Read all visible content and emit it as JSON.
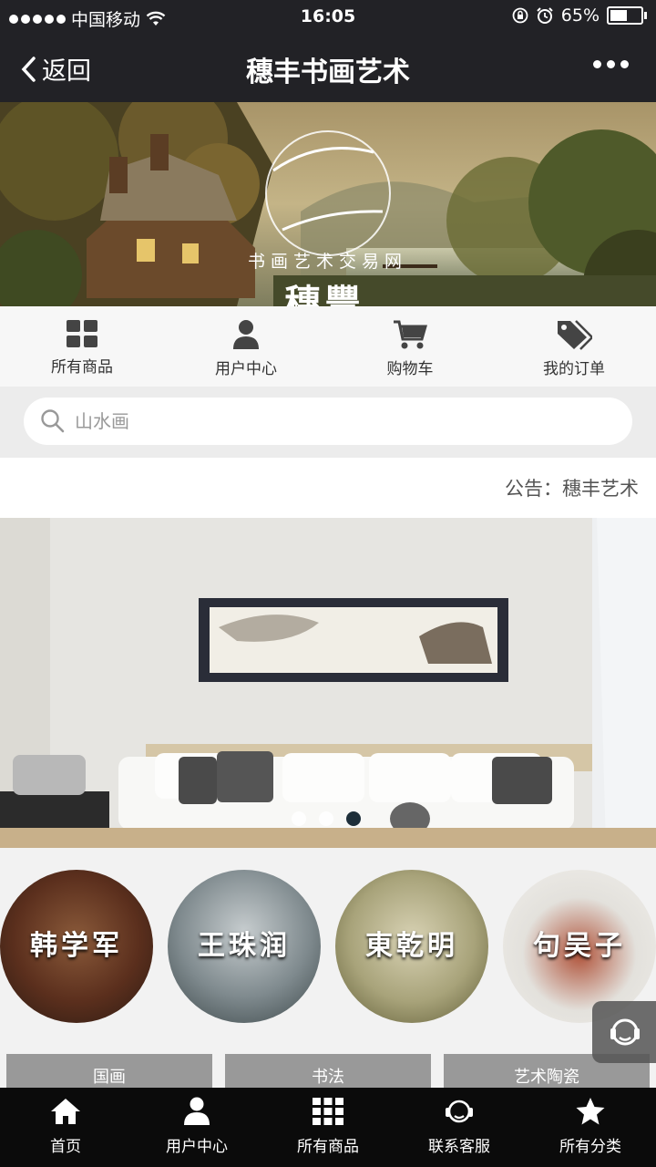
{
  "status_bar": {
    "carrier": "中国移动",
    "time": "16:05",
    "battery": "65%",
    "battery_level": 0.65
  },
  "navbar": {
    "back_label": "返回",
    "title": "穗丰书画艺术"
  },
  "banner": {
    "logo_main": "穗豐",
    "logo_sub": "书画艺术交易网"
  },
  "quick_menu": [
    {
      "label": "所有商品",
      "icon": "grid-icon"
    },
    {
      "label": "用户中心",
      "icon": "user-icon"
    },
    {
      "label": "购物车",
      "icon": "cart-icon"
    },
    {
      "label": "我的订单",
      "icon": "tag-icon"
    }
  ],
  "search": {
    "placeholder": "山水画"
  },
  "notice": {
    "text": "公告：穗丰艺术"
  },
  "hero": {
    "slide_count": 3,
    "active_slide": 3
  },
  "artists": [
    {
      "name": "韩学军"
    },
    {
      "name": "王珠润"
    },
    {
      "name": "東乾明"
    },
    {
      "name": "句吴子"
    }
  ],
  "categories": [
    {
      "label": "国画"
    },
    {
      "label": "书法"
    },
    {
      "label": "艺术陶瓷"
    }
  ],
  "tab_bar": [
    {
      "label": "首页",
      "icon": "home-icon"
    },
    {
      "label": "用户中心",
      "icon": "user-icon"
    },
    {
      "label": "所有商品",
      "icon": "grid-icon"
    },
    {
      "label": "联系客服",
      "icon": "headset-icon"
    },
    {
      "label": "所有分类",
      "icon": "star-icon"
    }
  ],
  "colors": {
    "header_bg": "#222226",
    "tabbar_bg": "#0b0b0b",
    "category_bg": "#999999"
  }
}
